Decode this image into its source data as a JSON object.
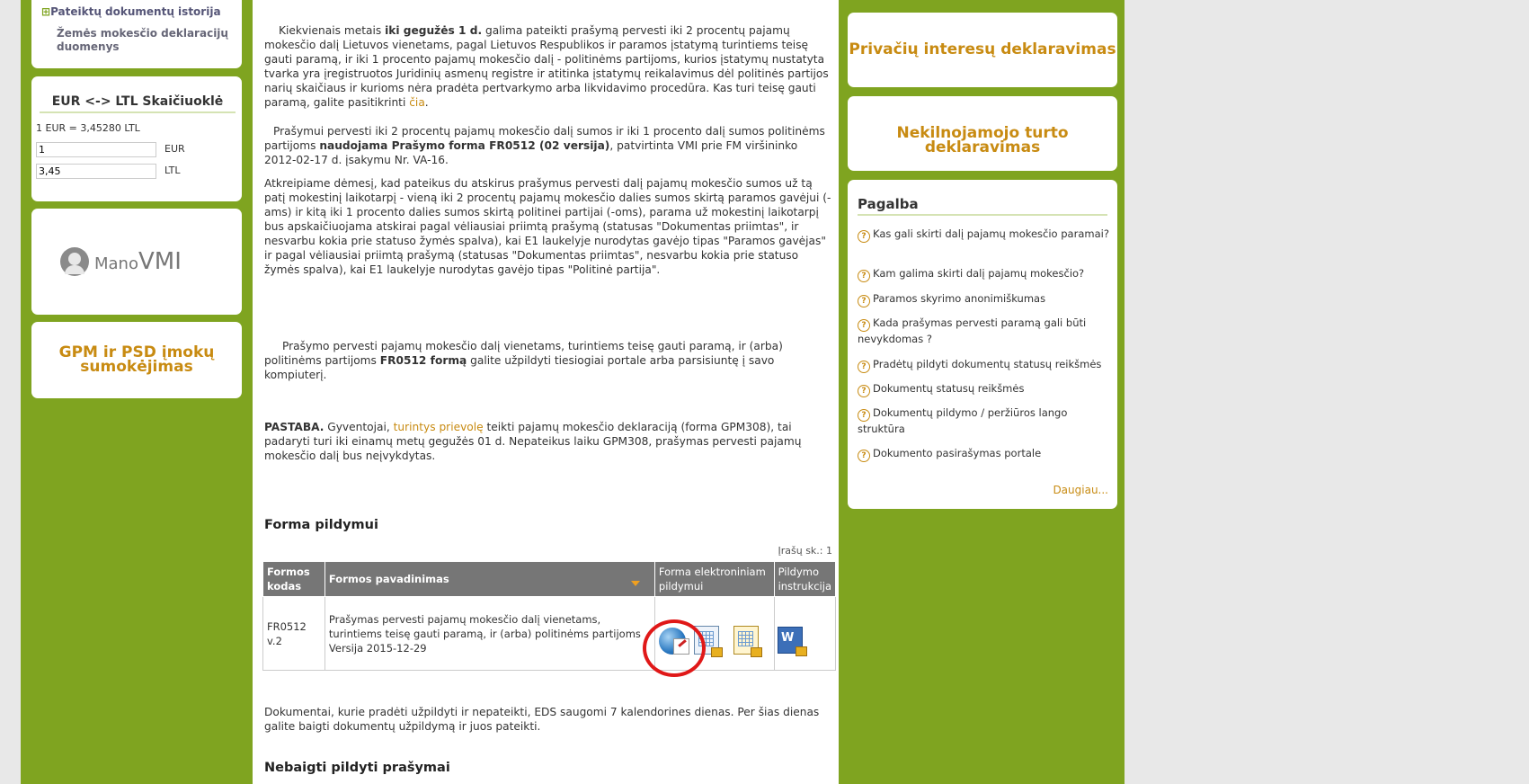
{
  "left_sidebar": {
    "history_link": "Pateiktų dokumentų istorija",
    "land_tax_link": "Žemės mokesčio deklaracijų duomenys",
    "calc_title": "EUR <-> LTL Skaičiuoklė",
    "calc_rate": "1 EUR = 3,45280 LTL",
    "eur_value": "1",
    "eur_label": "EUR",
    "ltl_value": "3,45",
    "ltl_label": "LTL",
    "mano_prefix": "Mano",
    "mano_suffix": "VMI",
    "gpm_title": "GPM ir PSD įmokų sumokėjimas"
  },
  "main": {
    "para1_pre": "Kiekvienais metais ",
    "para1_bold": "iki gegužės 1 d.",
    "para1_text": " galima pateikti prašymą pervesti iki 2 procentų pajamų mokesčio dalį Lietuvos vienetams, pagal Lietuvos Respublikos ir paramos įstatymą turintiems teisę gauti paramą, ir iki 1 procento pajamų mokesčio dalį - politinėms partijoms, kurios įstatymų nustatyta tvarka yra įregistruotos Juridinių asmenų registre ir atitinka įstatymų reikalavimus dėl politinės partijos narių skaičiaus ir kurioms nėra pradėta pertvarkymo arba likvidavimo procedūra. Kas turi teisę gauti paramą, galite pasitikrinti ",
    "para1_link": "čia",
    "para1_end": ".",
    "para2_pre": "Prašymui pervesti iki 2 procentų pajamų mokesčio dalį sumos ir iki 1 procento dalį sumos politinėms partijoms ",
    "para2_bold": "naudojama Prašymo forma FR0512 (02 versija)",
    "para2_end": ", patvirtinta VMI prie FM viršininko 2012-02-17 d. įsakymu Nr. VA-16.",
    "para3": "Atkreipiame dėmesį, kad pateikus du atskirus prašymus pervesti dalį pajamų mokesčio sumos už tą patį mokestinį laikotarpį - vieną iki 2 procentų pajamų mokesčio dalies sumos skirtą paramos gavėjui (-ams) ir kitą iki 1 procento dalies sumos skirtą politinei partijai (-oms), parama už mokestinį laikotarpį bus apskaičiuojama atskirai pagal vėliausiai priimtą prašymą (statusas \"Dokumentas priimtas\", ir nesvarbu kokia prie statuso žymės spalva), kai E1 laukelyje nurodytas gavėjo tipas \"Paramos gavėjas\" ir pagal vėliausiai priimtą prašymą (statusas \"Dokumentas priimtas\", nesvarbu kokia prie statuso žymės spalva), kai E1 laukelyje nurodytas gavėjo tipas \"Politinė partija\".",
    "para4_pre": "Prašymo pervesti pajamų mokesčio dalį vienetams, turintiems teisę gauti paramą, ir (arba) politinėms partijoms ",
    "para4_bold": "FR0512 formą",
    "para4_end": " galite užpildyti tiesiogiai portale arba parsisiuntę į savo kompiuterį.",
    "note_bold": "PASTABA.",
    "note_pre": " Gyventojai, ",
    "note_link": "turintys prievolę",
    "note_end": " teikti pajamų mokesčio deklaraciją (forma GPM308), tai padaryti turi iki einamų metų gegužės 01 d. Nepateikus laiku GPM308, prašymas pervesti pajamų mokesčio dalį bus neįvykdytas.",
    "form_heading": "Forma pildymui",
    "record_count": "Įrašų sk.: 1",
    "table_headers": {
      "code": "Formos kodas",
      "name": "Formos pavadinimas",
      "electronic": "Forma elektroniniam pildymui",
      "instructions": "Pildymo instrukcija"
    },
    "row": {
      "code": "FR0512 v.2",
      "name": "Prašymas pervesti pajamų mokesčio dalį vienetams, turintiems teisę gauti paramą, ir (arba) politinėms partijoms",
      "version": "Versija 2015-12-29"
    },
    "saved_note": "Dokumentai, kurie pradėti užpildyti ir nepateikti, EDS saugomi 7 kalendorines dienas. Per šias dienas galite baigti dokumentų užpildymą ir juos pateikti.",
    "unfinished_heading": "Nebaigti pildyti prašymai"
  },
  "right_sidebar": {
    "private_title": "Privačių interesų deklaravimas",
    "realestate_title": "Nekilnojamojo turto deklaravimas",
    "help_title": "Pagalba",
    "help_items": [
      "Kas gali skirti dalį pajamų mokesčio paramai?",
      "Kam galima skirti dalį pajamų mokesčio?",
      "Paramos skyrimo anonimiškumas",
      "Kada prašymas pervesti paramą gali būti nevykdomas ?",
      "Pradėtų pildyti dokumentų statusų reikšmės",
      "Dokumentų statusų reikšmės",
      "Dokumentų pildymo / peržiūros lango struktūra",
      "Dokumento pasirašymas portale"
    ],
    "more_link": "Daugiau..."
  },
  "colors": {
    "green": "#7fa420",
    "orange": "#c88b12",
    "header_gray": "#767676",
    "highlight_red": "#e01818"
  },
  "icons": [
    "globe-edit-icon",
    "form-doc-icon",
    "form-doc-lock-icon",
    "word-doc-icon"
  ]
}
